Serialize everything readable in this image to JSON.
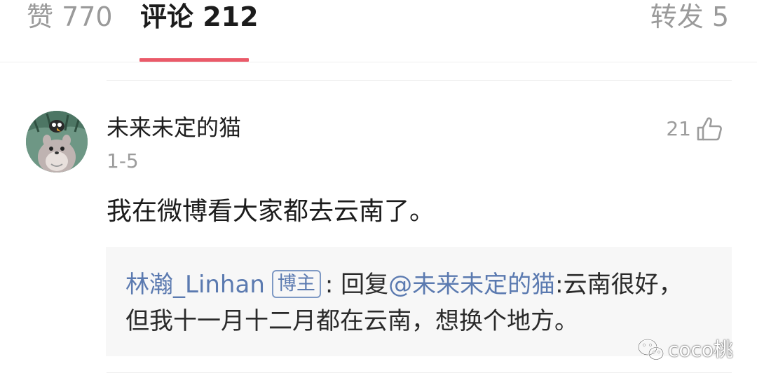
{
  "tabs": {
    "likes": "赞 770",
    "comments": "评论 212",
    "reposts": "转发 5",
    "active": "comments"
  },
  "colors": {
    "accent": "#ea5a69",
    "link_blue": "#5b7ab0",
    "muted": "#9c9c9c",
    "reply_bg": "#f7f7f7"
  },
  "comment": {
    "avatar_icon": "cartoon-avatar",
    "username": "未来未定的猫",
    "date": "1-5",
    "like_count": "21",
    "like_icon": "thumbs-up-icon",
    "text": "我在微博看大家都去云南了。",
    "reply": {
      "author": "林瀚_Linhan",
      "badge": "博主",
      "separator": ": ",
      "action": "回复",
      "mention": "@未来未定的猫",
      "text": ":云南很好，但我十一月十二月都在云南，想换个地方。"
    }
  },
  "watermark": {
    "icon": "wechat-icon",
    "text": "coco桃"
  }
}
